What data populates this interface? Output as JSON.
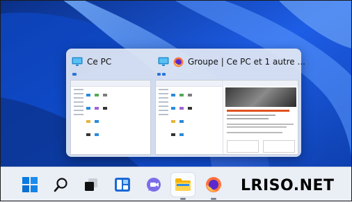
{
  "flyout": {
    "thumbnails": [
      {
        "title": "Ce PC",
        "app_icon": "monitor-icon"
      },
      {
        "title": "Groupe | Ce PC et 1 autre ...",
        "app_icons": [
          "monitor-icon",
          "firefox-icon"
        ]
      }
    ]
  },
  "taskbar": {
    "items": [
      {
        "name": "start",
        "icon": "windows-logo-icon"
      },
      {
        "name": "search",
        "icon": "search-icon"
      },
      {
        "name": "task-view",
        "icon": "task-view-icon"
      },
      {
        "name": "widgets",
        "icon": "widgets-icon"
      },
      {
        "name": "teams-chat",
        "icon": "teams-chat-icon"
      },
      {
        "name": "file-explorer",
        "icon": "file-explorer-icon",
        "active": true
      },
      {
        "name": "firefox",
        "icon": "firefox-icon"
      }
    ]
  },
  "watermark": "LRISO.NET",
  "colors": {
    "wallpaper": "#0b3a8c",
    "taskbar": "#eaeef5",
    "flyout": "#e2e8f4"
  }
}
